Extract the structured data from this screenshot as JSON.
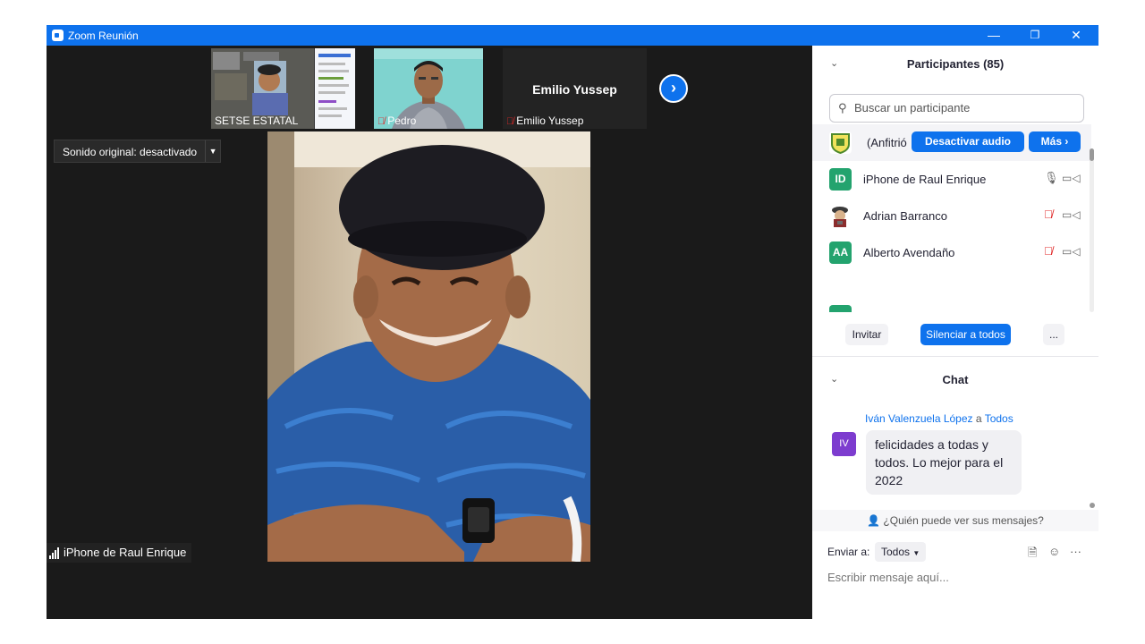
{
  "window": {
    "title": "Zoom Reunión",
    "minimize": "—",
    "restore": "❐",
    "close": "✕"
  },
  "thumbnails": [
    {
      "name": "SETSE ESTATAL",
      "muted": false
    },
    {
      "name": "Pedro",
      "muted": true
    },
    {
      "name": "Emilio Yussep",
      "muted": true,
      "display_name": "Emilio Yussep"
    }
  ],
  "next_arrow": "›",
  "audio_dropdown": {
    "label": "Sonido original: desactivado",
    "arrow": "▼"
  },
  "active_speaker": {
    "name": "iPhone de Raul Enrique"
  },
  "participants": {
    "title": "Participantes (85)",
    "search_placeholder": "Buscar un participante",
    "host": {
      "name": "(Anfitrió",
      "mute_button": "Desactivar audio",
      "more_button": "Más ›"
    },
    "list": [
      {
        "initials": "ID",
        "name": "iPhone de Raul Enrique",
        "avatar_color": "#23a36e",
        "mic": "🎙",
        "muted": false
      },
      {
        "initials": "",
        "name": "Adrian Barranco",
        "avatar_color": "#ffffff",
        "mic": "🎙",
        "muted": true
      },
      {
        "initials": "AA",
        "name": "Alberto Avendaño",
        "avatar_color": "#23a36e",
        "mic": "🎙",
        "muted": true
      }
    ],
    "invite_button": "Invitar",
    "mute_all_button": "Silenciar a todos",
    "more_options": "..."
  },
  "chat": {
    "title": "Chat",
    "message": {
      "sender": "Iván Valenzuela López",
      "to_word": "a",
      "recipient": "Todos",
      "initials": "IV",
      "text": "felicidades a todas y todos. Lo mejor para el 2022"
    },
    "who_sees": "¿Quién puede ver sus mensajes?",
    "send_to_label": "Enviar a:",
    "send_to_value": "Todos",
    "input_placeholder": "Escribir mensaje aquí..."
  },
  "colors": {
    "accent": "#0e72ed",
    "titlebar": "#0e72ed",
    "muted_red": "#e02828"
  }
}
